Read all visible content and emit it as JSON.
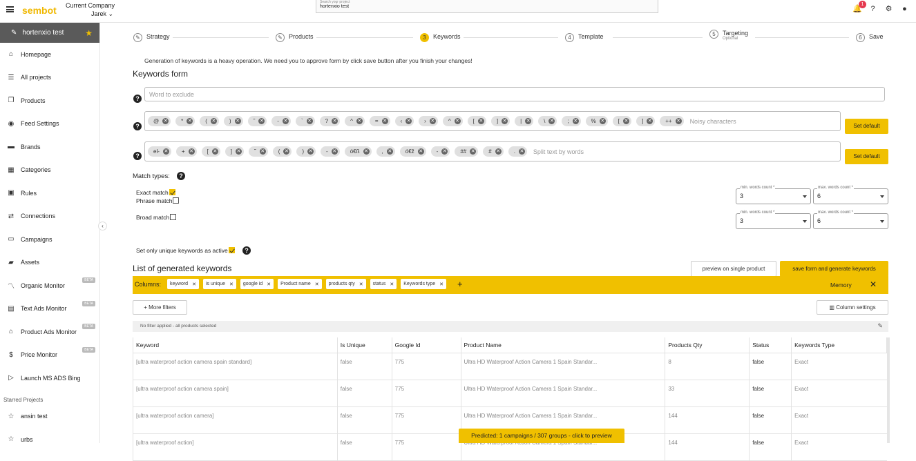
{
  "header": {
    "logo": "sembot",
    "company_label": "Current Company",
    "company_name": "Jarek",
    "search_placeholder": "Search your project",
    "search_value": "hortenxio test",
    "notifications": "1"
  },
  "sidebar": {
    "project": "hortenxio test",
    "items": [
      {
        "label": "Homepage",
        "icon": "⌂"
      },
      {
        "label": "All projects",
        "icon": "☰"
      },
      {
        "label": "Products",
        "icon": "❐"
      },
      {
        "label": "Feed Settings",
        "icon": "◉"
      },
      {
        "label": "Brands",
        "icon": "▬"
      },
      {
        "label": "Categories",
        "icon": "▦"
      },
      {
        "label": "Rules",
        "icon": "▣"
      },
      {
        "label": "Connections",
        "icon": "⇄"
      },
      {
        "label": "Campaigns",
        "icon": "▭"
      },
      {
        "label": "Assets",
        "icon": "▰"
      },
      {
        "label": "Organic Monitor",
        "icon": "〽",
        "beta": "BETA"
      },
      {
        "label": "Text Ads Monitor",
        "icon": "▤",
        "beta": "BETA"
      },
      {
        "label": "Product Ads Monitor",
        "icon": "⌂",
        "beta": "BETA"
      },
      {
        "label": "Price Monitor",
        "icon": "$",
        "beta": "BETA"
      },
      {
        "label": "Launch MS ADS Bing",
        "icon": "▷"
      }
    ],
    "starred_label": "Starred Projects",
    "starred": [
      {
        "label": "ansin test"
      },
      {
        "label": "urbs"
      }
    ]
  },
  "steps": [
    {
      "num": "✎",
      "label": "Strategy"
    },
    {
      "num": "✎",
      "label": "Products"
    },
    {
      "num": "3",
      "label": "Keywords"
    },
    {
      "num": "4",
      "label": "Template"
    },
    {
      "num": "5",
      "label": "Targeting",
      "optional": "Optional"
    },
    {
      "num": "6",
      "label": "Save"
    }
  ],
  "notice": "Generation of keywords is a heavy operation. We need you to approve form by click save button after you finish your changes!",
  "form": {
    "title": "Keywords form",
    "exclude_placeholder": "Word to exclude",
    "noisy": [
      "@",
      "*",
      "(",
      ")",
      "˜",
      "-",
      "`",
      "?",
      "^",
      "=",
      "‹",
      "›",
      "^",
      "[",
      "]",
      "|",
      "\\",
      ";",
      "%",
      "[",
      "]",
      "++"
    ],
    "noisy_placeholder": "Noisy characters",
    "split": [
      "el-",
      "+",
      "[",
      "]",
      "˜",
      "(",
      ")",
      "-",
      "ó€ß",
      ",",
      "ó€ž",
      "-",
      "##",
      "#",
      "."
    ],
    "split_placeholder": "Split text by words",
    "set_default": "Set default",
    "match_types": "Match types:",
    "exact": "Exact match",
    "phrase": "Phrase match",
    "broad": "Broad match",
    "min_label": "min. words count *",
    "max_label": "max. words count *",
    "min1": "3",
    "max1": "6",
    "min2": "3",
    "max2": "6",
    "unique": "Set only unique keywords as active"
  },
  "list": {
    "title": "List of generated keywords",
    "preview_btn": "preview on single product",
    "save_btn": "save form and generate keywords",
    "columns_label": "Columns:",
    "columns": [
      "keyword",
      "is unique",
      "google id",
      "Product name",
      "products qty",
      "status",
      "Keywords type"
    ],
    "memory": "Memory",
    "more_filters": "More filters",
    "column_settings": "Column settings",
    "filter_text": "No filter applied - all products selected"
  },
  "table": {
    "headers": [
      "Keyword",
      "Is Unique",
      "Google Id",
      "Product Name",
      "Products Qty",
      "Status",
      "Keywords Type"
    ],
    "rows": [
      [
        "[ultra waterproof action camera spain standard]",
        "false",
        "775",
        "Ultra HD Waterproof Action Camera 1 Spain Standar...",
        "8",
        "false",
        "Exact"
      ],
      [
        "[ultra waterproof action camera spain]",
        "false",
        "775",
        "Ultra HD Waterproof Action Camera 1 Spain Standar...",
        "33",
        "false",
        "Exact"
      ],
      [
        "[ultra waterproof action camera]",
        "false",
        "775",
        "Ultra HD Waterproof Action Camera 1 Spain Standar...",
        "144",
        "false",
        "Exact"
      ],
      [
        "[ultra waterproof action]",
        "false",
        "775",
        "Ultra HD Waterproof Action Camera 1 Spain Standar...",
        "144",
        "false",
        "Exact"
      ]
    ]
  },
  "predicted": "Predicted: 1 campaigns / 307 groups - click to preview"
}
